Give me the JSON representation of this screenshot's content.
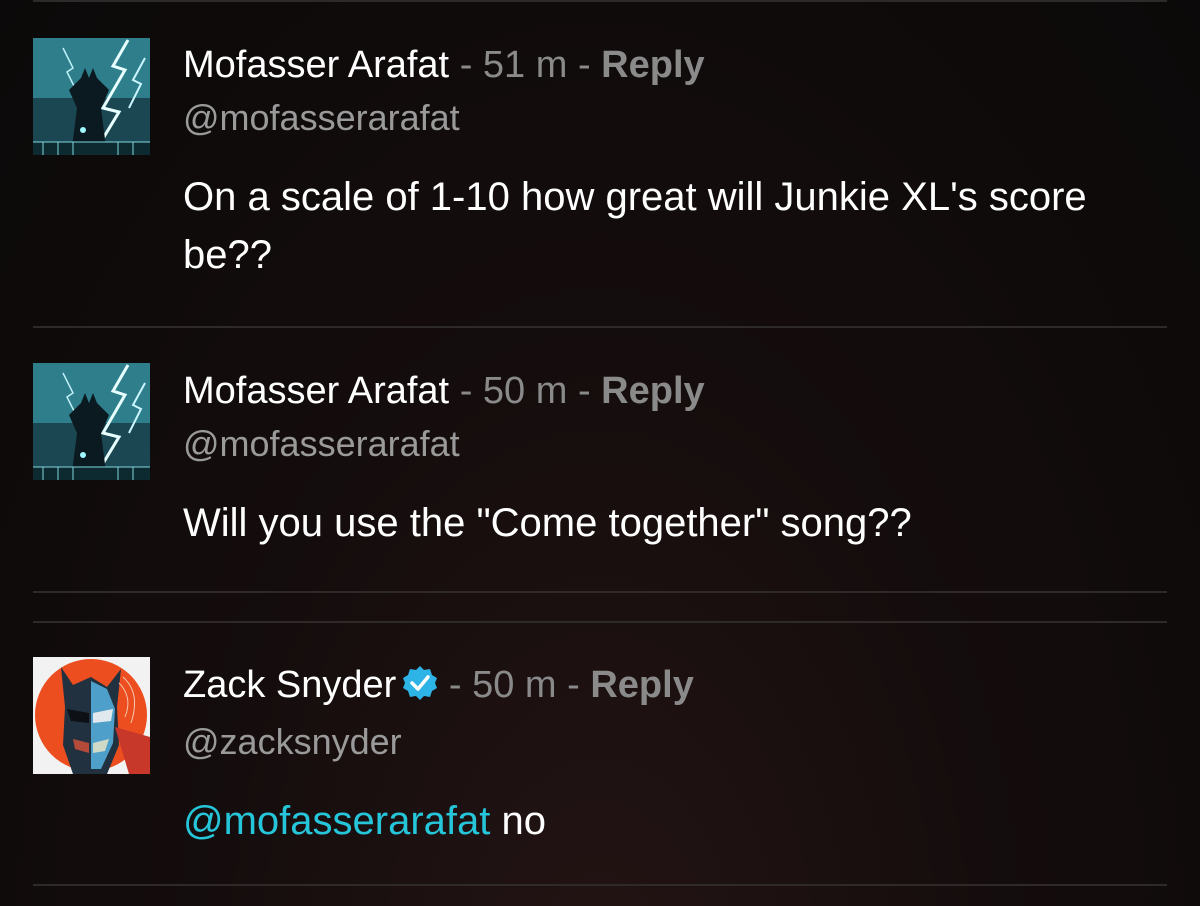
{
  "comments": [
    {
      "name": "Mofasser Arafat",
      "separator": "-",
      "time": "51 m",
      "reply_label": "Reply",
      "handle": "@mofasserarafat",
      "text": "On a scale of 1-10 how great will Junkie XL's score be??",
      "avatar_icon": "batman-lightning-avatar"
    },
    {
      "name": "Mofasser Arafat",
      "separator": "-",
      "time": "50 m",
      "reply_label": "Reply",
      "handle": "@mofasserarafat",
      "text": "Will you use the \"Come together\" song??",
      "avatar_icon": "batman-lightning-avatar"
    },
    {
      "name": "Zack Snyder",
      "verified": true,
      "separator": "-",
      "time": "50 m",
      "reply_label": "Reply",
      "handle": "@zacksnyder",
      "mention": "@mofasserarafat",
      "text": "no",
      "avatar_icon": "painted-mask-avatar"
    }
  ],
  "colors": {
    "mention": "#26c6da",
    "verified_badge": "#2db3e6",
    "muted": "#8a8a8a"
  }
}
